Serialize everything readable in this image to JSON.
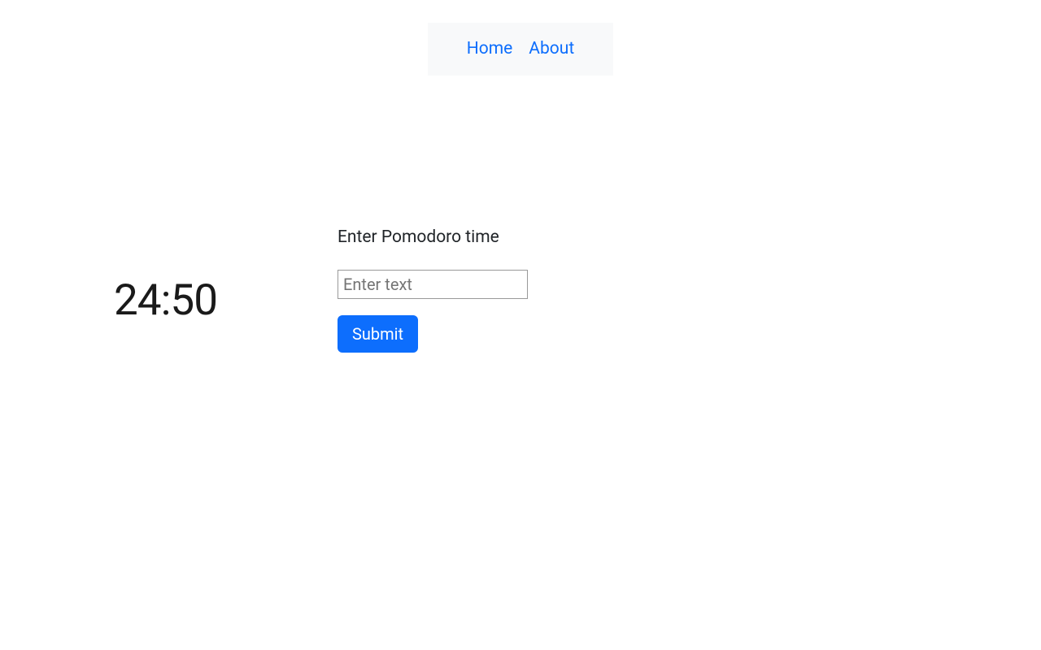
{
  "nav": {
    "home_label": "Home",
    "about_label": "About"
  },
  "timer": {
    "display": "24:50"
  },
  "form": {
    "label": "Enter Pomodoro time",
    "input_placeholder": "Enter text",
    "input_value": "",
    "submit_label": "Submit"
  }
}
